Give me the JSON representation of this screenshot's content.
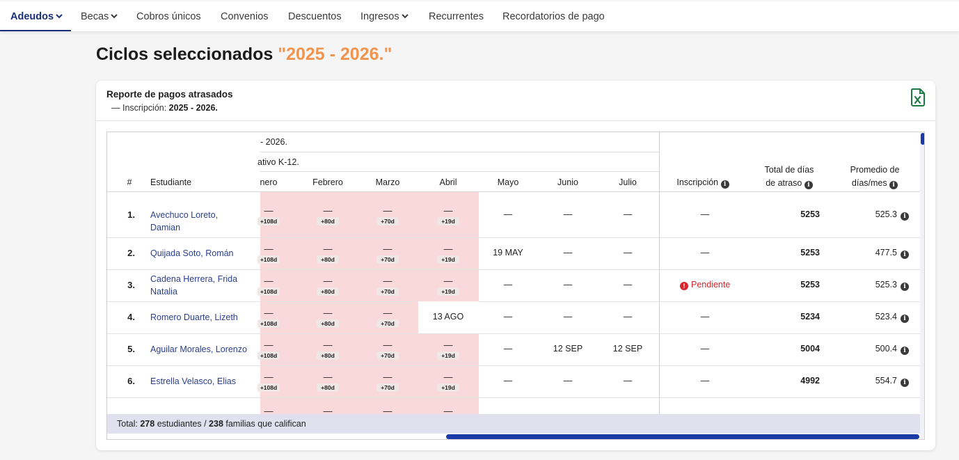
{
  "nav": {
    "tabs": [
      {
        "label": "Adeudos",
        "caret": true,
        "active": true
      },
      {
        "label": "Becas",
        "caret": true
      },
      {
        "label": "Cobros únicos"
      },
      {
        "label": "Convenios"
      },
      {
        "label": "Descuentos"
      },
      {
        "label": "Ingresos",
        "caret": true
      },
      {
        "label": "Recurrentes"
      },
      {
        "label": "Recordatorios de pago"
      }
    ]
  },
  "page": {
    "title_prefix": "Ciclos seleccionados ",
    "title_highlight": "\"2025 - 2026.\"",
    "highlight_color": "#f0954f"
  },
  "report": {
    "title": "Reporte de pagos atrasados",
    "sub_prefix": "— Inscripción: ",
    "sub_value": "2025 - 2026.",
    "export_icon": "excel-icon",
    "group_label_1": "- 2026.",
    "group_label_2": "ativo K-12.",
    "col_num": "#",
    "col_student": "Estudiante",
    "months": [
      "nero",
      "Febrero",
      "Marzo",
      "Abril",
      "Mayo",
      "Junio",
      "Julio"
    ],
    "col_inscripcion": "Inscripción",
    "col_total_1": "Total de días",
    "col_total_2": "de atraso",
    "col_avg_1": "Promedio de",
    "col_avg_2": "días/mes",
    "late_color": "#f9d9d9",
    "rows": [
      {
        "n": "1.",
        "name": "Avechuco Loreto, Damian",
        "months": [
          {
            "v": "—",
            "b": "+108d"
          },
          {
            "v": "—",
            "b": "+80d"
          },
          {
            "v": "—",
            "b": "+70d"
          },
          {
            "v": "—",
            "b": "+19d"
          },
          {
            "v": "—"
          },
          {
            "v": "—"
          },
          {
            "v": "—"
          }
        ],
        "inscripcion": "—",
        "pending": false,
        "total": "5253",
        "avg": "525.3"
      },
      {
        "n": "2.",
        "name": "Quijada Soto, Román",
        "months": [
          {
            "v": "—",
            "b": "+108d"
          },
          {
            "v": "—",
            "b": "+80d"
          },
          {
            "v": "—",
            "b": "+70d"
          },
          {
            "v": "—",
            "b": "+19d"
          },
          {
            "v": "19 MAY"
          },
          {
            "v": "—"
          },
          {
            "v": "—"
          }
        ],
        "inscripcion": "—",
        "pending": false,
        "total": "5253",
        "avg": "477.5"
      },
      {
        "n": "3.",
        "name": "Cadena Herrera, Frida Natalia",
        "months": [
          {
            "v": "—",
            "b": "+108d"
          },
          {
            "v": "—",
            "b": "+80d"
          },
          {
            "v": "—",
            "b": "+70d"
          },
          {
            "v": "—",
            "b": "+19d"
          },
          {
            "v": "—"
          },
          {
            "v": "—"
          },
          {
            "v": "—"
          }
        ],
        "inscripcion": "Pendiente",
        "pending": true,
        "total": "5253",
        "avg": "525.3"
      },
      {
        "n": "4.",
        "name": "Romero Duarte, Lizeth",
        "months": [
          {
            "v": "—",
            "b": "+108d"
          },
          {
            "v": "—",
            "b": "+80d"
          },
          {
            "v": "—",
            "b": "+70d"
          },
          {
            "v": "13 AGO"
          },
          {
            "v": "—"
          },
          {
            "v": "—"
          },
          {
            "v": "—"
          }
        ],
        "inscripcion": "—",
        "pending": false,
        "total": "5234",
        "avg": "523.4"
      },
      {
        "n": "5.",
        "name": "Aguilar Morales, Lorenzo",
        "months": [
          {
            "v": "—",
            "b": "+108d"
          },
          {
            "v": "—",
            "b": "+80d"
          },
          {
            "v": "—",
            "b": "+70d"
          },
          {
            "v": "—",
            "b": "+19d"
          },
          {
            "v": "—"
          },
          {
            "v": "12 SEP"
          },
          {
            "v": "12 SEP"
          }
        ],
        "inscripcion": "—",
        "pending": false,
        "total": "5004",
        "avg": "500.4"
      },
      {
        "n": "6.",
        "name": "Estrella Velasco, Elias",
        "months": [
          {
            "v": "—",
            "b": "+108d"
          },
          {
            "v": "—",
            "b": "+80d"
          },
          {
            "v": "—",
            "b": "+70d"
          },
          {
            "v": "—",
            "b": "+19d"
          },
          {
            "v": "—"
          },
          {
            "v": "—"
          },
          {
            "v": "—"
          }
        ],
        "inscripcion": "—",
        "pending": false,
        "total": "4992",
        "avg": "554.7"
      }
    ],
    "partial_row_marks": [
      "—",
      "—",
      "—",
      "—"
    ],
    "footer": {
      "prefix": "Total: ",
      "students": "278",
      "students_label": " estudiantes  /  ",
      "families": "238",
      "families_label": " familias que califican"
    }
  }
}
